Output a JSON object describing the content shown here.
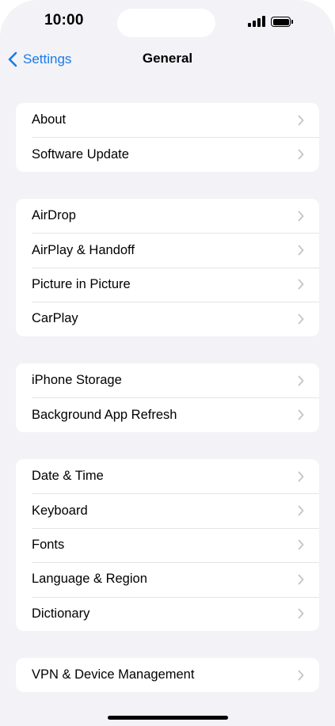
{
  "status_bar": {
    "time": "10:00",
    "signal_icon": "cellular-signal-icon",
    "battery_icon": "battery-icon"
  },
  "nav": {
    "back_label": "Settings",
    "back_icon": "chevron-left-icon",
    "title": "General"
  },
  "colors": {
    "accent": "#1a7ae8",
    "background": "#f2f2f7",
    "cell": "#ffffff",
    "chevron": "#c4c4c7"
  },
  "groups": [
    {
      "items": [
        {
          "label": "About"
        },
        {
          "label": "Software Update"
        }
      ]
    },
    {
      "items": [
        {
          "label": "AirDrop"
        },
        {
          "label": "AirPlay & Handoff"
        },
        {
          "label": "Picture in Picture"
        },
        {
          "label": "CarPlay"
        }
      ]
    },
    {
      "items": [
        {
          "label": "iPhone Storage"
        },
        {
          "label": "Background App Refresh"
        }
      ]
    },
    {
      "items": [
        {
          "label": "Date & Time"
        },
        {
          "label": "Keyboard"
        },
        {
          "label": "Fonts"
        },
        {
          "label": "Language & Region"
        },
        {
          "label": "Dictionary"
        }
      ]
    },
    {
      "items": [
        {
          "label": "VPN & Device Management"
        }
      ]
    }
  ]
}
